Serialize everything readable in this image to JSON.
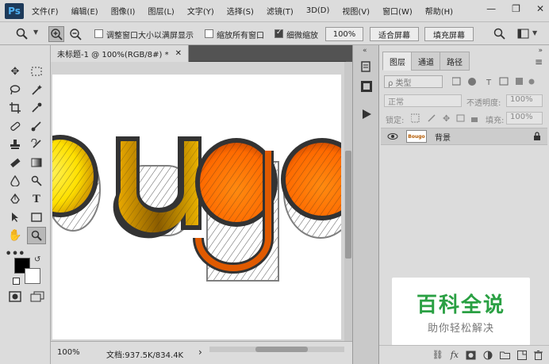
{
  "app": {
    "logo": "Ps"
  },
  "menu": [
    "文件(F)",
    "编辑(E)",
    "图像(I)",
    "图层(L)",
    "文字(Y)",
    "选择(S)",
    "滤镜(T)",
    "3D(D)",
    "视图(V)",
    "窗口(W)",
    "帮助(H)"
  ],
  "window_controls": {
    "minimize": "—",
    "restore": "❐",
    "close": "✕"
  },
  "options": {
    "resize_windows": "调整窗口大小以满屏显示",
    "zoom_all": "缩放所有窗口",
    "scrubby_zoom": "细微缩放",
    "zoom_value": "100%",
    "fit_screen": "适合屏幕",
    "fill_screen": "填充屏幕"
  },
  "document": {
    "tab_title": "未标题-1 @ 100%(RGB/8#) *",
    "close": "✕",
    "text_art": "ougo",
    "status_zoom": "100%",
    "status_doc": "文档:937.5K/834.4K",
    "status_arrow": "›"
  },
  "panel": {
    "tabs": [
      "图层",
      "通道",
      "路径"
    ],
    "kind_label": "ρ 类型",
    "blend_mode": "正常",
    "opacity_label": "不透明度:",
    "opacity_value": "100%",
    "lock_label": "锁定:",
    "fill_label": "填充:",
    "fill_value": "100%",
    "layer_name": "背景",
    "thumb_text": "Bougo"
  },
  "watermark": {
    "title": "百科全说",
    "subtitle": "助你轻松解决"
  },
  "colors": {
    "yellow": "#ffe000",
    "orange": "#ff6f00",
    "brand_green": "#2aa043"
  }
}
